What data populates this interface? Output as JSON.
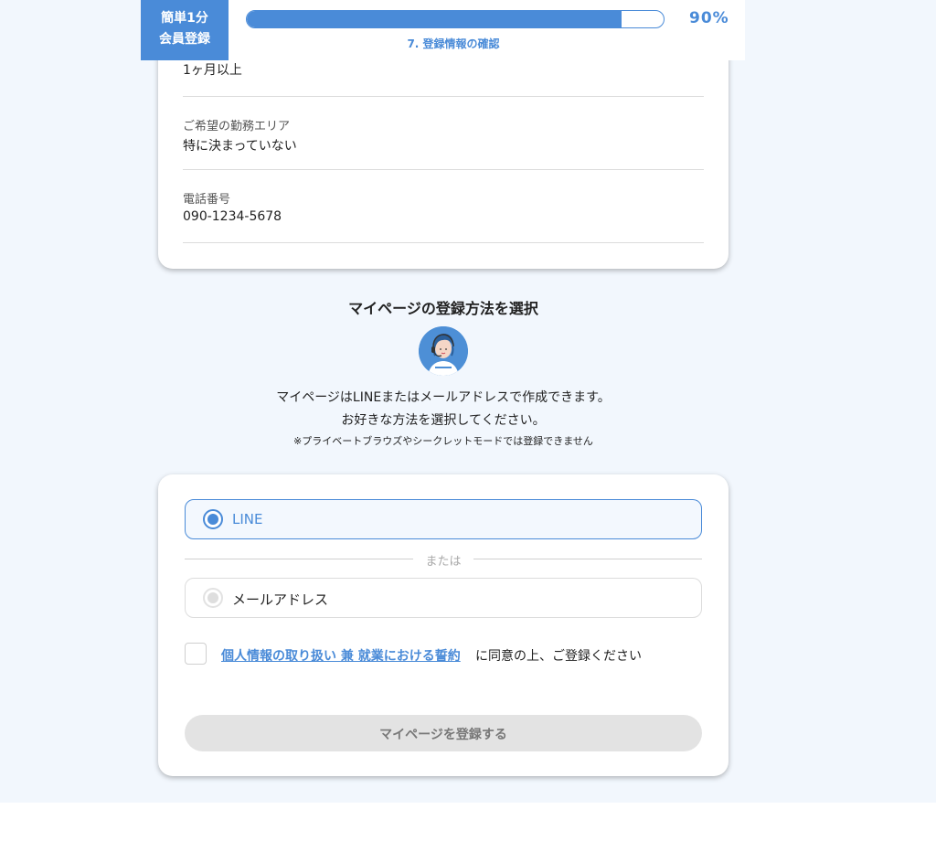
{
  "header": {
    "badge_line1": "簡単1分",
    "badge_line2": "会員登録",
    "progress_percent": 90,
    "progress_text": "90%",
    "step_label": "7. 登録情報の確認"
  },
  "summary": {
    "rows": [
      {
        "label": "",
        "value": "1ヶ月以上"
      },
      {
        "label": "ご希望の勤務エリア",
        "value": "特に決まっていない"
      },
      {
        "label": "電話番号",
        "value": "090-1234-5678"
      }
    ]
  },
  "mypage": {
    "title": "マイページの登録方法を選択",
    "desc_line1": "マイページはLINEまたはメールアドレスで作成できます。",
    "desc_line2": "お好きな方法を選択してください。",
    "note": "※プライベートブラウズやシークレットモードでは登録できません"
  },
  "options": {
    "line_label": "LINE",
    "line_selected": true,
    "divider_text": "または",
    "mail_label": "メールアドレス",
    "mail_selected": false
  },
  "consent": {
    "link_text": "個人情報の取り扱い 兼 就業における誓約",
    "suffix_text": "に同意の上、ご登録ください",
    "checked": false
  },
  "submit": {
    "label": "マイページを登録する",
    "enabled": false
  },
  "colors": {
    "accent": "#4a8bd8",
    "page_bg": "#f2f7fd",
    "disabled_button": "#e3e3e3"
  }
}
